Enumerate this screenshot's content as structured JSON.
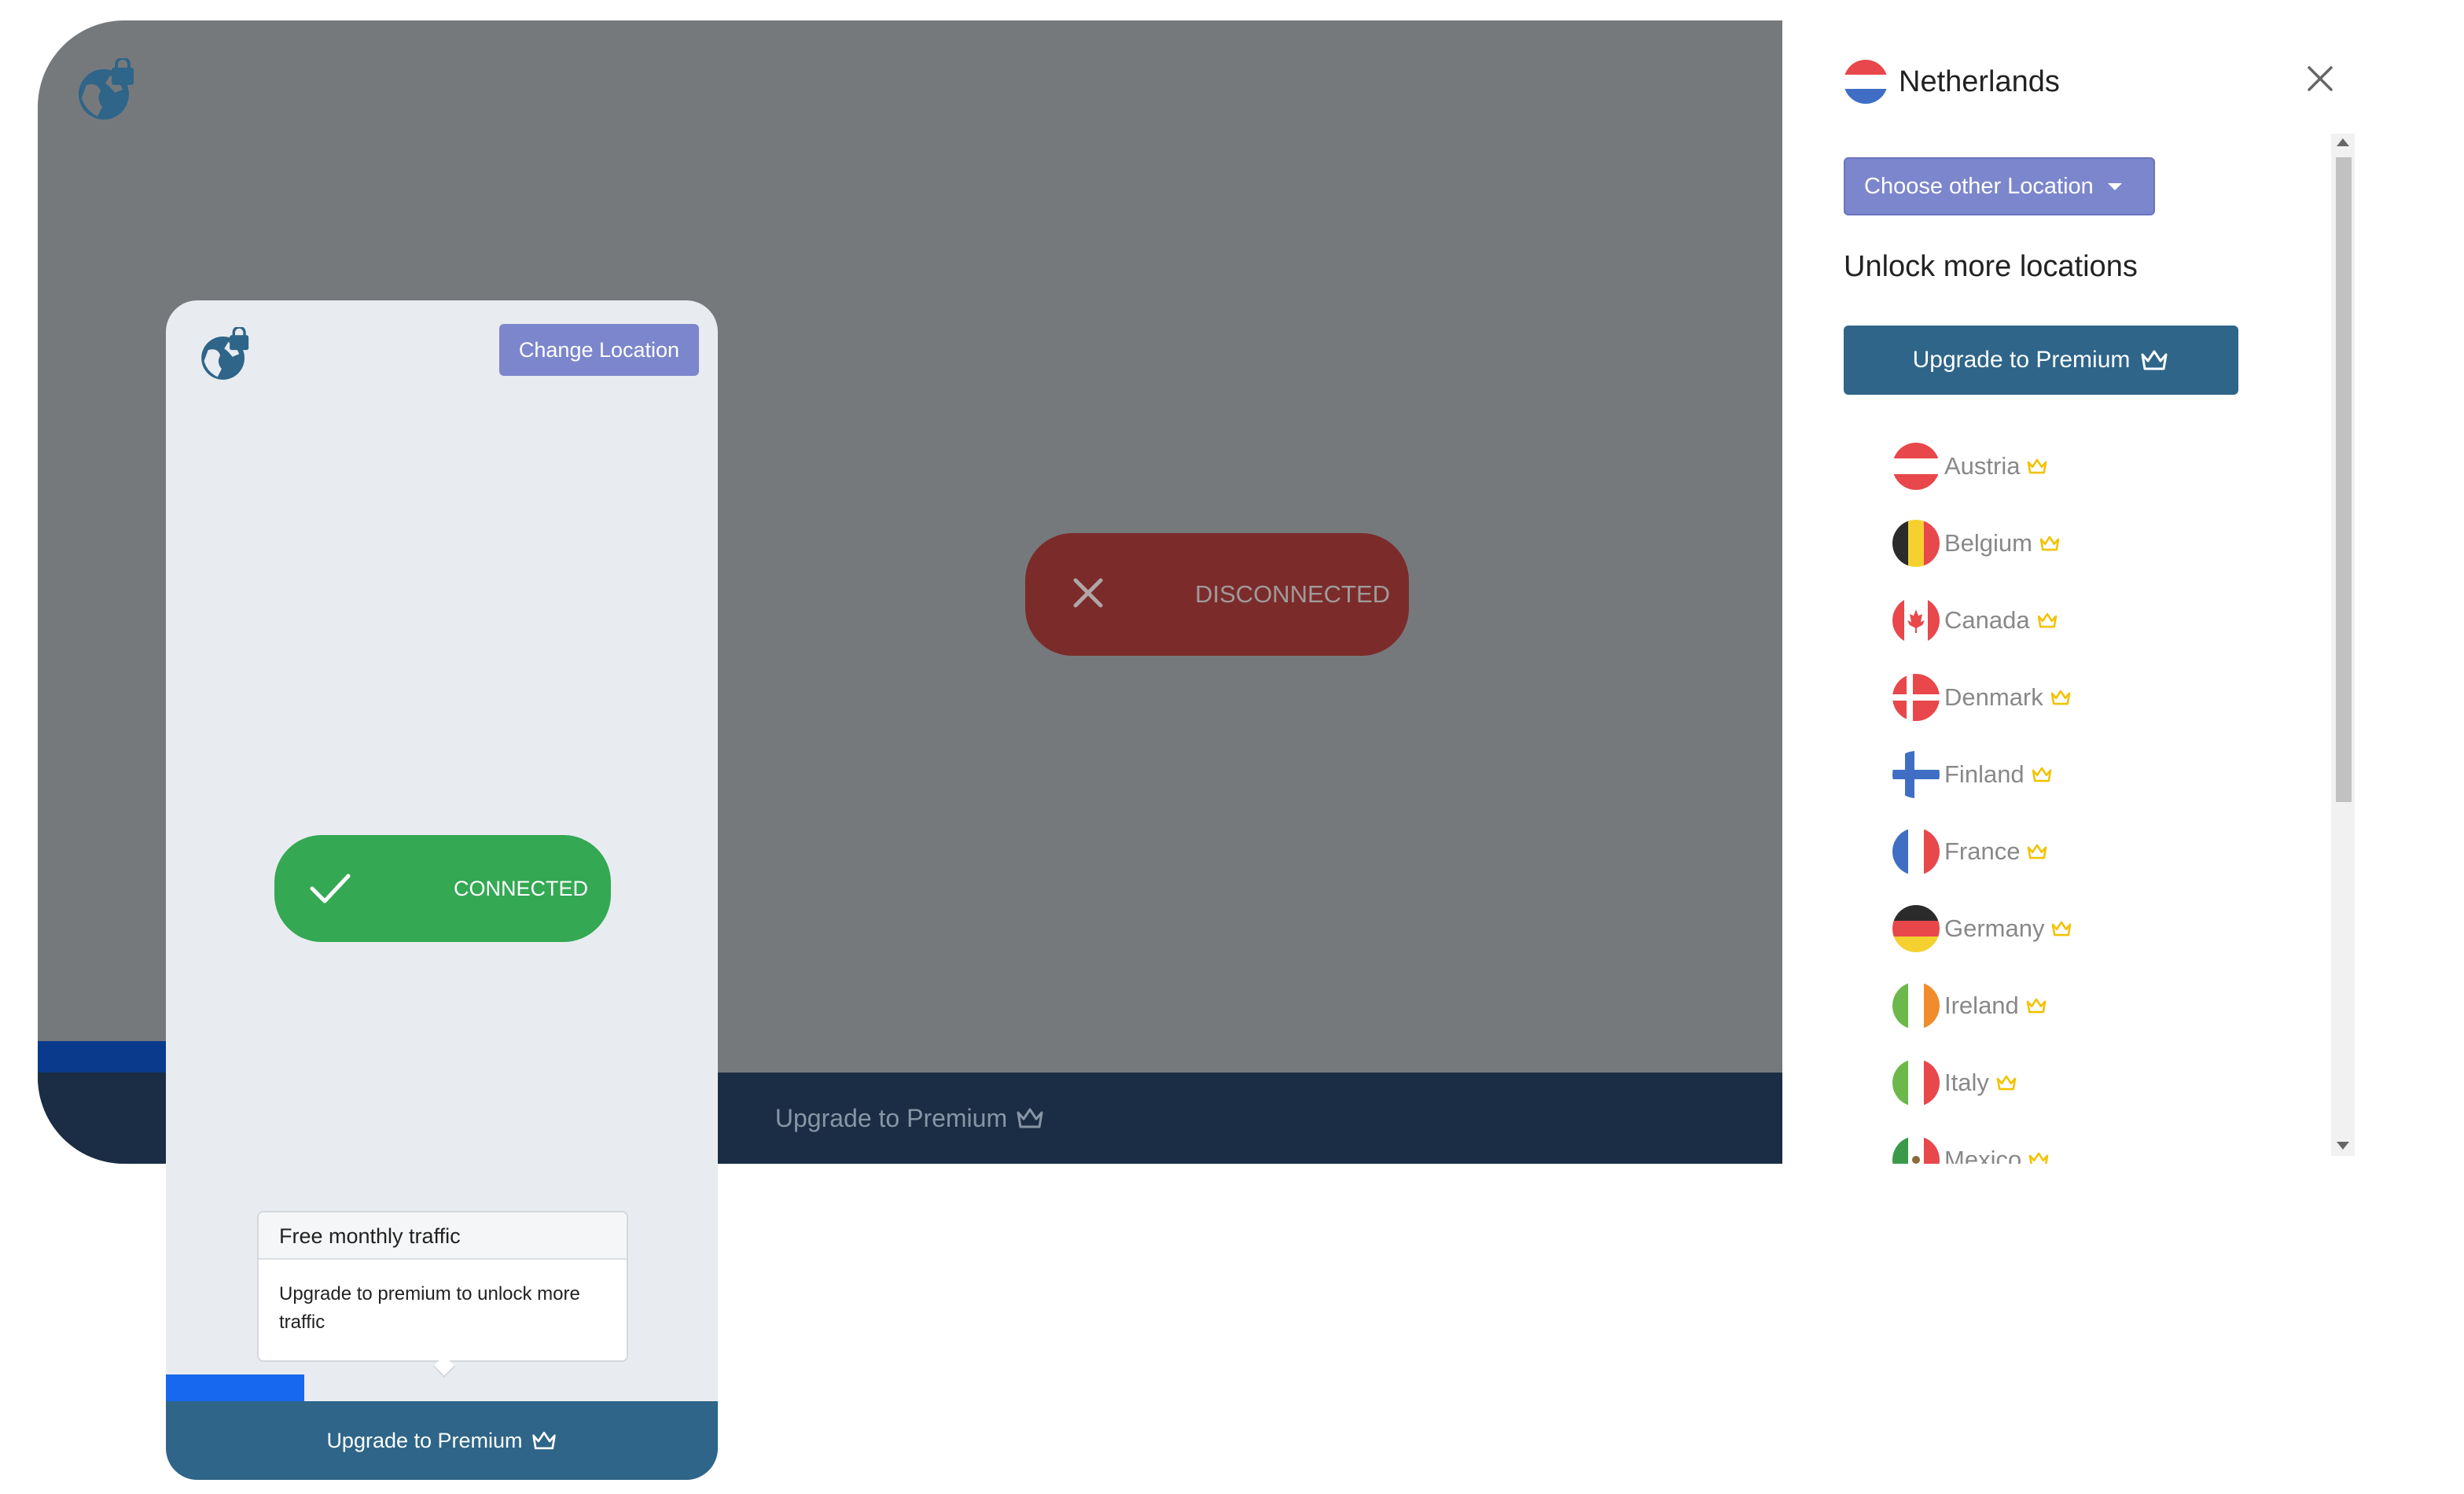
{
  "background_window": {
    "status_label": "DISCONNECTED",
    "footer_upgrade_label": "Upgrade to Premium"
  },
  "popup": {
    "change_location_label": "Change Location",
    "status_label": "CONNECTED",
    "tooltip": {
      "title": "Free monthly traffic",
      "body": "Upgrade to premium to unlock more traffic"
    },
    "upgrade_label": "Upgrade to Premium"
  },
  "panel": {
    "current_location": "Netherlands",
    "choose_location_label": "Choose other Location",
    "unlock_heading": "Unlock more locations",
    "upgrade_label": "Upgrade to Premium",
    "locations": [
      {
        "name": "Austria"
      },
      {
        "name": "Belgium"
      },
      {
        "name": "Canada"
      },
      {
        "name": "Denmark"
      },
      {
        "name": "Finland"
      },
      {
        "name": "France"
      },
      {
        "name": "Germany"
      },
      {
        "name": "Ireland"
      },
      {
        "name": "Italy"
      },
      {
        "name": "Mexico"
      }
    ]
  },
  "colors": {
    "accent_purple": "#7b86cc",
    "premium_blue": "#2e6589",
    "connected_green": "#34a853",
    "disconnected_red": "#7b2c2a",
    "crown_gold": "#f2c200"
  },
  "icons": {
    "logo": "globe-lock-icon",
    "close": "close-icon",
    "crown": "crown-icon",
    "check": "check-icon",
    "disconnect": "x-icon"
  }
}
